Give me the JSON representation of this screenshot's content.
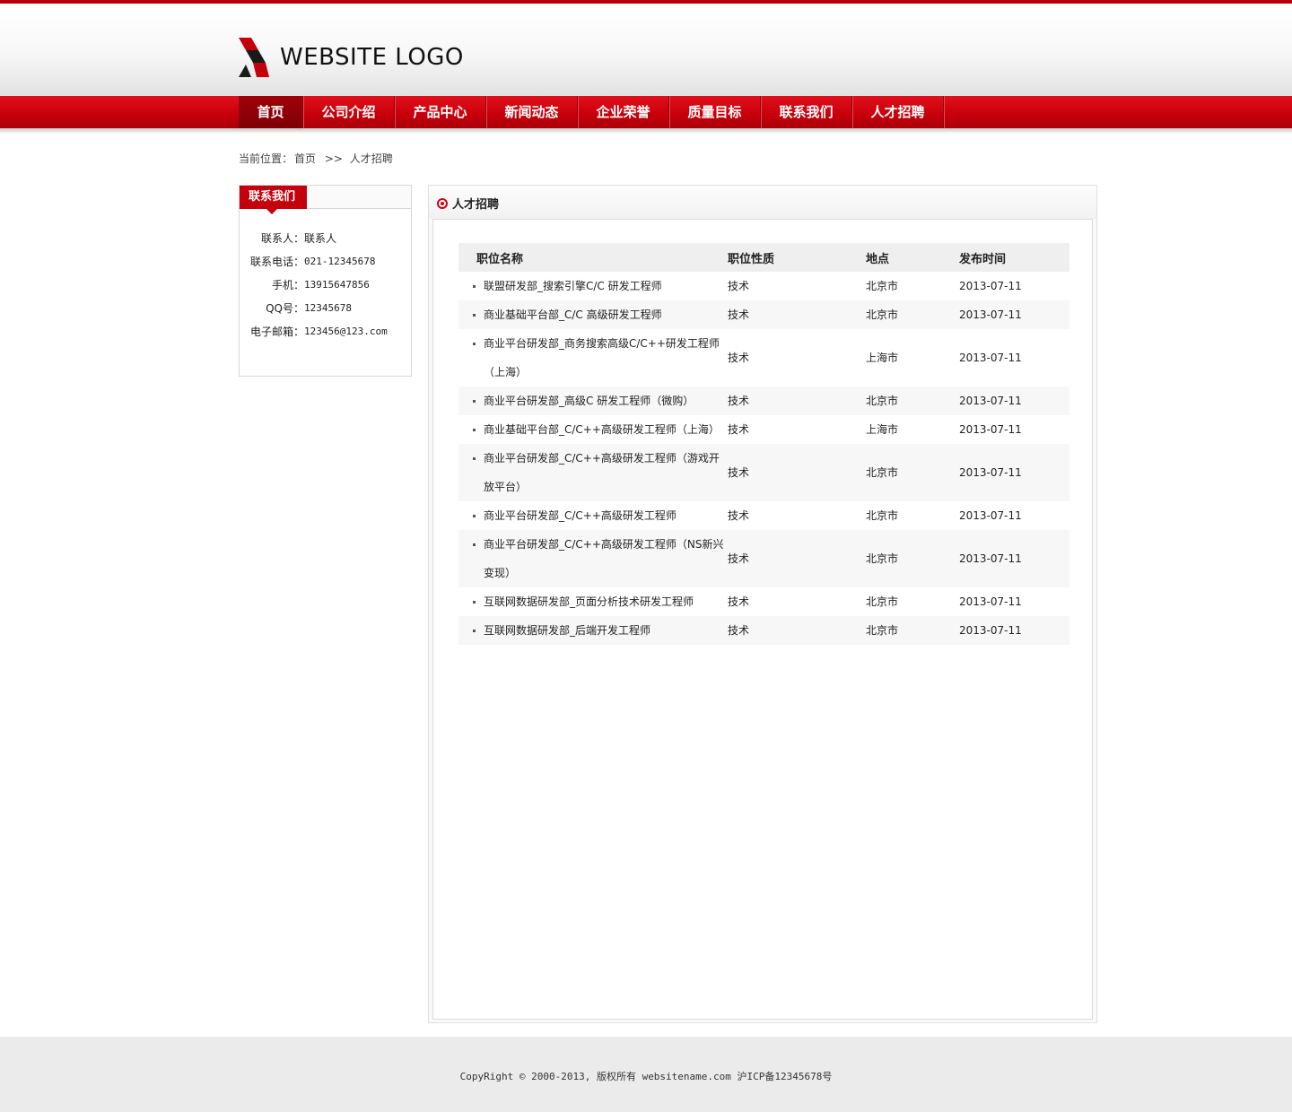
{
  "header": {
    "logo_text": "WEBSITE LOGO",
    "accent_color": "#c4000d"
  },
  "nav": {
    "items": [
      {
        "label": "首页"
      },
      {
        "label": "公司介绍"
      },
      {
        "label": "产品中心"
      },
      {
        "label": "新闻动态"
      },
      {
        "label": "企业荣誉"
      },
      {
        "label": "质量目标"
      },
      {
        "label": "联系我们"
      },
      {
        "label": "人才招聘"
      }
    ]
  },
  "breadcrumb": {
    "prefix": "当前位置：",
    "home": "首页",
    "separator": ">>",
    "current": "人才招聘"
  },
  "sidebar": {
    "title": "联系我们",
    "contact": [
      {
        "label": "联系人：",
        "value": "联系人"
      },
      {
        "label": "联系电话：",
        "value": "021-12345678"
      },
      {
        "label": "手机：",
        "value": "13915647856"
      },
      {
        "label": "QQ号：",
        "value": "12345678"
      },
      {
        "label": "电子邮箱：",
        "value": "123456@123.com"
      }
    ]
  },
  "main": {
    "title": "人才招聘",
    "columns": [
      "职位名称",
      "职位性质",
      "地点",
      "发布时间"
    ],
    "jobs": [
      {
        "title": "联盟研发部_搜索引擎C/C 研发工程师",
        "type": "技术",
        "location": "北京市",
        "date": "2013-07-11"
      },
      {
        "title": "商业基础平台部_C/C 高级研发工程师",
        "type": "技术",
        "location": "北京市",
        "date": "2013-07-11"
      },
      {
        "title": "商业平台研发部_商务搜索高级C/C++研发工程师（上海）",
        "type": "技术",
        "location": "上海市",
        "date": "2013-07-11"
      },
      {
        "title": "商业平台研发部_高级C 研发工程师（微购）",
        "type": "技术",
        "location": "北京市",
        "date": "2013-07-11"
      },
      {
        "title": "商业基础平台部_C/C++高级研发工程师（上海）",
        "type": "技术",
        "location": "上海市",
        "date": "2013-07-11"
      },
      {
        "title": "商业平台研发部_C/C++高级研发工程师（游戏开放平台）",
        "type": "技术",
        "location": "北京市",
        "date": "2013-07-11"
      },
      {
        "title": "商业平台研发部_C/C++高级研发工程师",
        "type": "技术",
        "location": "北京市",
        "date": "2013-07-11"
      },
      {
        "title": "商业平台研发部_C/C++高级研发工程师（NS新兴变现）",
        "type": "技术",
        "location": "北京市",
        "date": "2013-07-11"
      },
      {
        "title": "互联网数据研发部_页面分析技术研发工程师",
        "type": "技术",
        "location": "北京市",
        "date": "2013-07-11"
      },
      {
        "title": "互联网数据研发部_后端开发工程师",
        "type": "技术",
        "location": "北京市",
        "date": "2013-07-11"
      }
    ]
  },
  "footer": {
    "text": "CopyRight © 2000-2013, 版权所有 websitename.com 沪ICP备12345678号"
  }
}
